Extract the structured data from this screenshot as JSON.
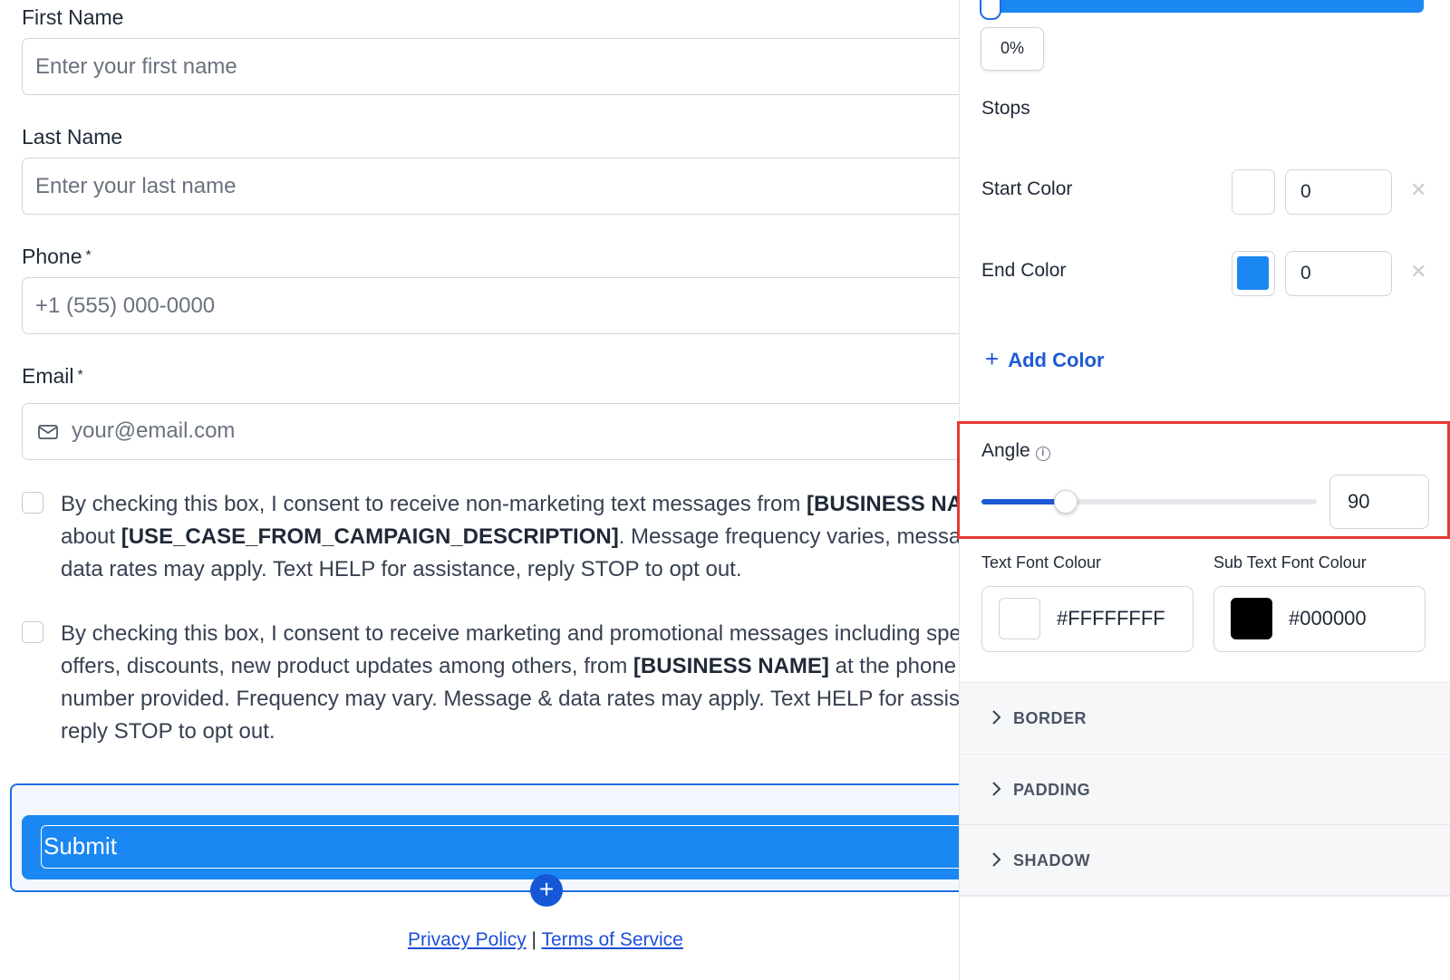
{
  "form": {
    "first_name": {
      "label": "First Name",
      "placeholder": "Enter your first name"
    },
    "last_name": {
      "label": "Last Name",
      "placeholder": "Enter your last name"
    },
    "phone": {
      "label": "Phone",
      "required_mark": "*",
      "placeholder": "+1 (555) 000-0000"
    },
    "email": {
      "label": "Email",
      "required_mark": "*",
      "placeholder": "your@email.com",
      "icon": "envelope-icon"
    },
    "consent_transactional": {
      "text_1": "By checking this box, I consent to receive non-marketing text messages from ",
      "bold_1": "[BUSINESS NAME]",
      "text_2": " about ",
      "bold_2": "[USE_CASE_FROM_CAMPAIGN_DESCRIPTION]",
      "text_3": ". Message frequency varies, message & data rates may apply. Text HELP for assistance, reply STOP to opt out."
    },
    "consent_marketing": {
      "text_1": "By checking this box, I consent to receive marketing and promotional messages including special offers, discounts, new product updates among others, from ",
      "bold_1": "[BUSINESS NAME]",
      "text_2": " at the phone number provided. Frequency may vary. Message & data rates may apply. Text HELP for assistance, reply STOP to opt out."
    },
    "submit_label": "Submit",
    "add_block_symbol": "+",
    "footer": {
      "privacy": "Privacy Policy",
      "separator": "|",
      "terms": "Terms of Service"
    }
  },
  "panel": {
    "gradient": {
      "position_percent": "0%",
      "bar_color": "#1b87f3"
    },
    "stops_title": "Stops",
    "stops": [
      {
        "label": "Start Color",
        "color": "#ffffff",
        "value": "0",
        "remove_symbol": "✕"
      },
      {
        "label": "End Color",
        "color": "#1b87f3",
        "value": "0",
        "remove_symbol": "✕"
      }
    ],
    "add_color_label": "Add Color",
    "angle": {
      "label": "Angle",
      "info_symbol": "i",
      "value": "90",
      "slider_fraction": 0.25
    },
    "text_font_colour": {
      "label": "Text Font Colour",
      "value": "#FFFFFFFF",
      "swatch": "#ffffff"
    },
    "sub_text_font_colour": {
      "label": "Sub Text Font Colour",
      "value": "#000000",
      "swatch": "#000000"
    },
    "sections": [
      "BORDER",
      "PADDING",
      "SHADOW"
    ]
  },
  "colors": {
    "accent": "#1b87f3",
    "link": "#1d4ed8",
    "highlight": "#e53935"
  }
}
